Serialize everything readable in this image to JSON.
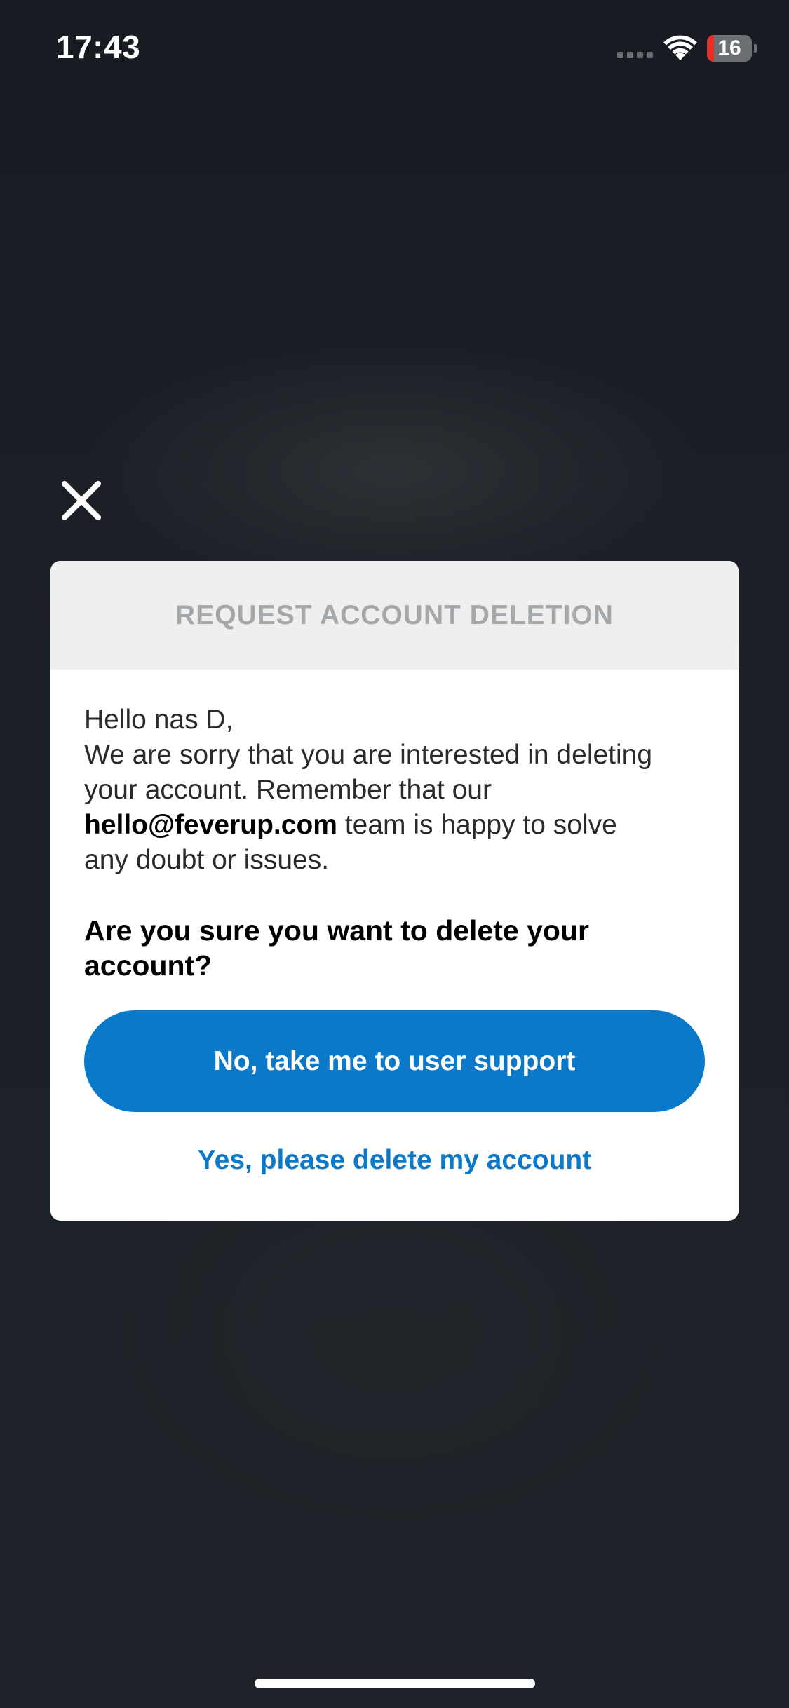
{
  "status_bar": {
    "time": "17:43",
    "battery_level": "16",
    "battery_fraction": 0.16
  },
  "colors": {
    "accent": "#0a79c9",
    "battery_low": "#e5302c",
    "header_bg": "#efefef",
    "backdrop": "#1b2026"
  },
  "icons": {
    "close": "close-icon",
    "wifi": "wifi-icon",
    "signal": "cellular-signal-icon",
    "battery": "battery-icon"
  },
  "dialog": {
    "title": "REQUEST ACCOUNT DELETION",
    "greeting": "Hello nas D,",
    "message_line_1": "We are sorry that you are interested in deleting",
    "message_line_2": "your account. Remember that our",
    "support_email": "hello@feverup.com",
    "message_line_3_rest": " team is happy to solve",
    "message_line_4": "any doubt or issues.",
    "question_line_1": "Are you sure you want to delete your",
    "question_line_2": "account?",
    "support_button_label": "No, take me to user support",
    "delete_link_label": "Yes, please delete my account"
  }
}
